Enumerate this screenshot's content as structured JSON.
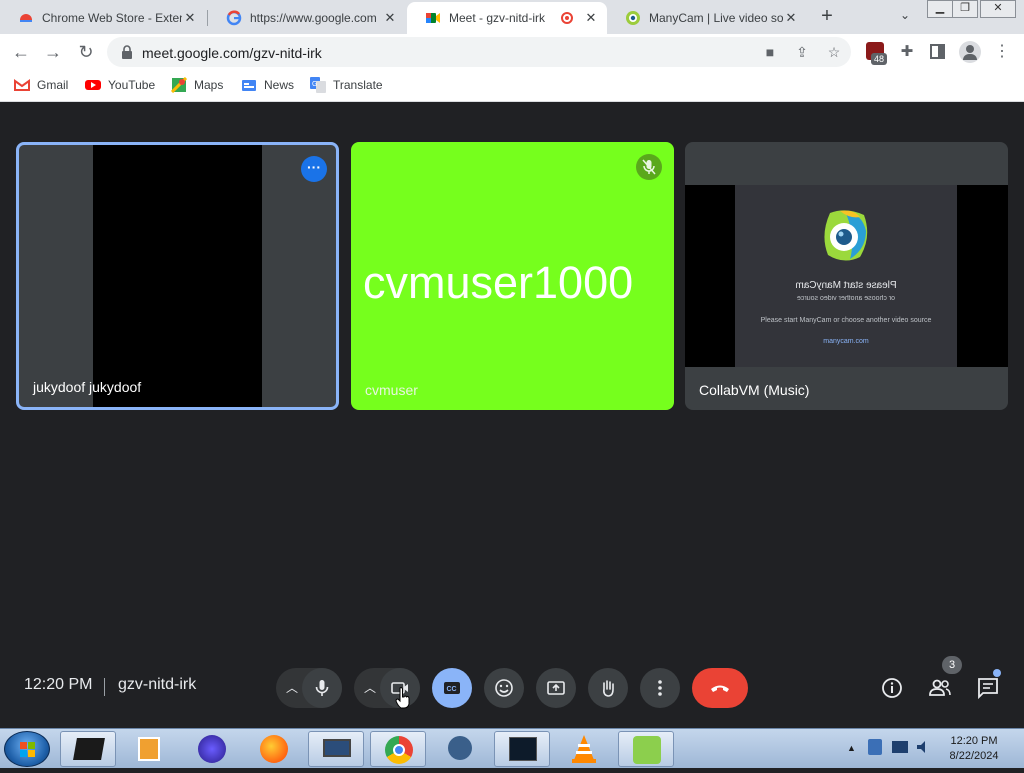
{
  "browser": {
    "tabs": [
      {
        "title": "Chrome Web Store - Extensions",
        "icon": "chrome-web-store-icon",
        "active": false
      },
      {
        "title": "https://www.google.com",
        "icon": "google-icon",
        "active": false
      },
      {
        "title": "Meet - gzv-nitd-irk",
        "icon": "google-meet-icon",
        "active": true,
        "recording": true
      },
      {
        "title": "ManyCam | Live video software",
        "icon": "manycam-icon",
        "active": false
      }
    ],
    "url": "meet.google.com/gzv-nitd-irk",
    "extension_badge": "48",
    "bookmarks": [
      {
        "label": "Gmail",
        "icon": "gmail-icon"
      },
      {
        "label": "YouTube",
        "icon": "youtube-icon"
      },
      {
        "label": "Maps",
        "icon": "maps-icon"
      },
      {
        "label": "News",
        "icon": "news-icon"
      },
      {
        "label": "Translate",
        "icon": "translate-icon"
      }
    ]
  },
  "meet": {
    "participants": [
      {
        "name": "jukydoof jukydoof",
        "state": "video-off-black",
        "pinned_highlight": true
      },
      {
        "name": "cvmuser",
        "big_label": "cvmuser1000",
        "state": "muted",
        "background": "#76ff1d"
      },
      {
        "name": "CollabVM (Music)",
        "state": "manycam-placeholder"
      }
    ],
    "manycam_screen": {
      "title": "Please start ManyCam",
      "subtitle": "or choose another video source",
      "message": "Please start ManyCam or choose another video source",
      "link": "manycam.com"
    },
    "time": "12:20 PM",
    "meeting_code": "gzv-nitd-irk",
    "people_count": "3",
    "accent": "#8ab4f8",
    "leave_color": "#ea4335"
  },
  "taskbar": {
    "time": "12:20 PM",
    "date": "8/22/2024"
  }
}
